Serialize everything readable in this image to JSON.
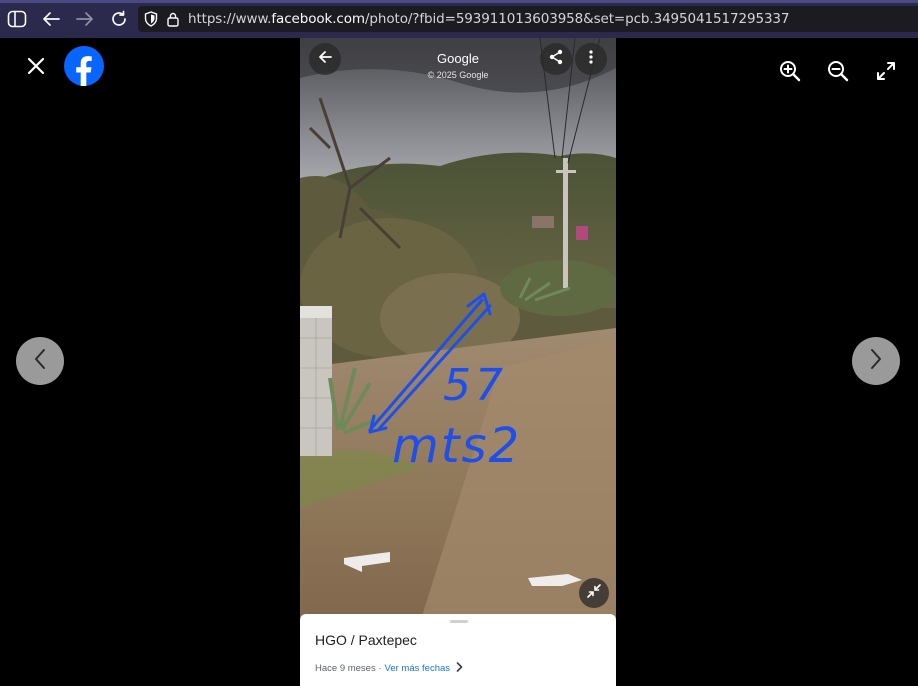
{
  "browser": {
    "url_prefix": "https://www.",
    "url_domain": "facebook.com",
    "url_path": "/photo/?fbid=593911013603958&set=pcb.3495041517295337"
  },
  "viewer": {
    "icons": [
      "close-icon",
      "facebook-logo",
      "zoom-in-icon",
      "zoom-out-icon",
      "fullscreen-icon",
      "chevron-left-icon",
      "chevron-right-icon"
    ]
  },
  "photo": {
    "header_title": "Google",
    "header_subtitle": "© 2025 Google",
    "annotation_text_1": "57",
    "annotation_text_2": "mts2",
    "annotation_color": "#1f4fe8",
    "location": "HGO / Paxtepec",
    "age_text": "Hace 9 meses ·",
    "more_dates_link": "Ver más fechas"
  }
}
